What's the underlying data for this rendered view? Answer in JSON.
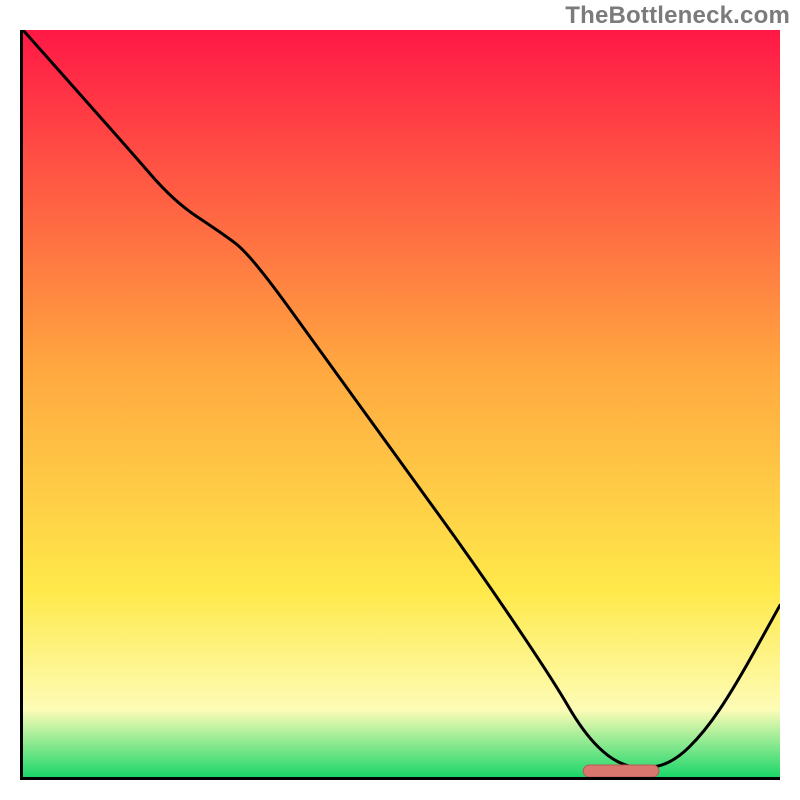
{
  "watermark": "TheBottleneck.com",
  "colors": {
    "gradient_top": "#ff1846",
    "gradient_mid": "#ffa740",
    "gradient_yellow": "#ffe94a",
    "gradient_paleyellow": "#fdfcb6",
    "gradient_green": "#1bd66a",
    "curve": "#000000",
    "marker_fill": "#d9776f",
    "marker_stroke": "#b85a53",
    "axis": "#000000"
  },
  "chart_data": {
    "type": "line",
    "title": "",
    "xlabel": "",
    "ylabel": "",
    "xlim": [
      0,
      100
    ],
    "ylim": [
      0,
      100
    ],
    "grid": false,
    "legend": false,
    "series": [
      {
        "name": "bottleneck-curve",
        "x": [
          0,
          7,
          14,
          20,
          26,
          30,
          40,
          50,
          60,
          70,
          74,
          78,
          82,
          86,
          90,
          94,
          100
        ],
        "y": [
          100,
          92,
          84,
          77,
          73,
          70,
          56,
          42,
          28,
          13,
          6,
          2,
          1,
          2,
          6,
          12,
          23
        ]
      }
    ],
    "annotations": [
      {
        "name": "optimal-marker",
        "shape": "rounded-bar",
        "x_start": 74,
        "x_end": 84,
        "y": 0.8
      }
    ]
  }
}
